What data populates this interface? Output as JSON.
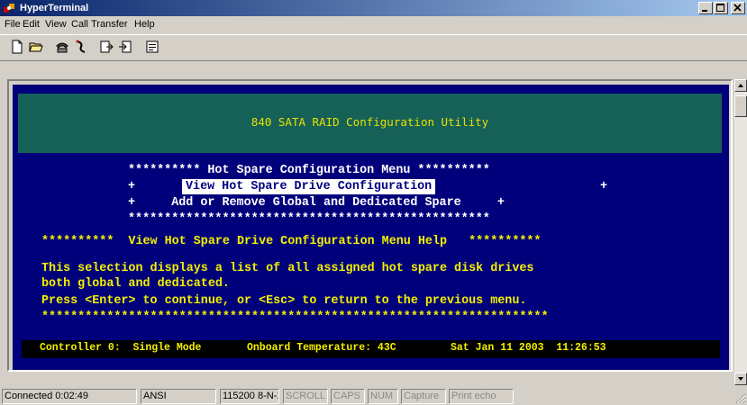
{
  "window": {
    "title": "HyperTerminal",
    "controls": [
      "minimize-icon",
      "maximize-icon",
      "close-icon"
    ]
  },
  "menu": {
    "items": [
      {
        "label": "File"
      },
      {
        "label": "Edit"
      },
      {
        "label": "View"
      },
      {
        "label": "Call"
      },
      {
        "label": "Transfer"
      },
      {
        "label": "Help"
      }
    ]
  },
  "toolbar": {
    "icons": [
      "new-icon",
      "open-icon",
      "connect-icon",
      "disconnect-icon",
      "send-icon",
      "receive-icon",
      "properties-icon"
    ]
  },
  "terminal": {
    "banner": "840 SATA RAID Configuration Utility",
    "menu_title": "********** Hot Spare Configuration Menu **********",
    "option1_prefix": "+",
    "option1": "View Hot Spare Drive Configuration",
    "option1_suffix": "+",
    "option2": "+     Add or Remove Global and Dedicated Spare     +",
    "menu_border": "**************************************************",
    "help_title": "**********  View Hot Spare Drive Configuration Menu Help   **********",
    "help_line1": "This selection displays a list of all assigned hot spare disk drives",
    "help_line2": "both global and dedicated.",
    "help_line3": "Press <Enter> to continue, or <Esc> to return to the previous menu.",
    "help_border": "**********************************************************************",
    "status": {
      "controller": "Controller 0:  Single Mode",
      "temperature": "Onboard Temperature: 43C",
      "datetime": "Sat Jan 11 2003  11:26:53"
    }
  },
  "statusbar": {
    "connected": "Connected 0:02:49",
    "emulation": "ANSI",
    "settings": "115200 8-N-1",
    "scroll": "SCROLL",
    "caps": "CAPS",
    "num": "NUM",
    "capture": "Capture",
    "print_echo": "Print echo"
  },
  "colors": {
    "terminal_bg": "#00007b",
    "banner_bg": "#156157",
    "text_yellow": "#f4f000",
    "text_white": "#ffffff"
  }
}
